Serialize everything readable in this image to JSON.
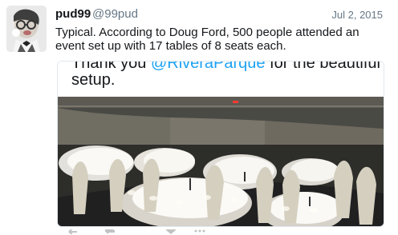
{
  "tweet": {
    "author_name": "pud99",
    "author_handle": "@99pud",
    "date": "Jul 2, 2015",
    "text": "Typical. According to Doug Ford, 500 people attended an event set up with 17 tables of 8 seats each.",
    "embedded_photo": {
      "caption_line_1_prefix": "Thank you ",
      "caption_line_1_mention": "@RiveraParque",
      "caption_line_1_suffix": " for the beautiful",
      "caption_line_2": "setup."
    }
  },
  "icons": {
    "avatar": "avatar-icon",
    "reply": "reply-icon",
    "retweet": "retweet-icon",
    "like": "like-icon",
    "more": "more-icon"
  },
  "colors": {
    "text": "#14171a",
    "secondary": "#657786",
    "mention": "#1da1f2",
    "border": "#e1e8ed"
  }
}
